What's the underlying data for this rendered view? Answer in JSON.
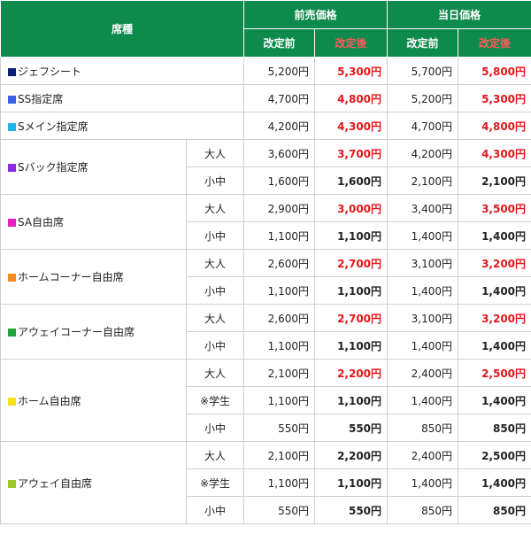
{
  "header": {
    "seat_type": "席種",
    "advance": "前売価格",
    "same_day": "当日価格",
    "before": "改定前",
    "after": "改定後"
  },
  "rows": [
    {
      "seat": "ジェフシート",
      "color": "#0b1f7a",
      "sub": "",
      "adv_old": "5,200円",
      "adv_new": "5,300円",
      "day_old": "5,700円",
      "day_new": "5,800円",
      "red": true
    },
    {
      "seat": "SS指定席",
      "color": "#3a5fe0",
      "sub": "",
      "adv_old": "4,700円",
      "adv_new": "4,800円",
      "day_old": "5,200円",
      "day_new": "5,300円",
      "red": true
    },
    {
      "seat": "Sメイン指定席",
      "color": "#1fb3e8",
      "sub": "",
      "adv_old": "4,200円",
      "adv_new": "4,300円",
      "day_old": "4,700円",
      "day_new": "4,800円",
      "red": true
    },
    {
      "seat": "Sバック指定席",
      "color": "#8b2be0",
      "sub": "大人",
      "adv_old": "3,600円",
      "adv_new": "3,700円",
      "day_old": "4,200円",
      "day_new": "4,300円",
      "red": true
    },
    {
      "seat": "",
      "color": "",
      "sub": "小中",
      "adv_old": "1,600円",
      "adv_new": "1,600円",
      "day_old": "2,100円",
      "day_new": "2,100円",
      "red": false
    },
    {
      "seat": "SA自由席",
      "color": "#e91ec2",
      "sub": "大人",
      "adv_old": "2,900円",
      "adv_new": "3,000円",
      "day_old": "3,400円",
      "day_new": "3,500円",
      "red": true
    },
    {
      "seat": "",
      "color": "",
      "sub": "小中",
      "adv_old": "1,100円",
      "adv_new": "1,100円",
      "day_old": "1,400円",
      "day_new": "1,400円",
      "red": false
    },
    {
      "seat": "ホームコーナー自由席",
      "color": "#f28c1f",
      "sub": "大人",
      "adv_old": "2,600円",
      "adv_new": "2,700円",
      "day_old": "3,100円",
      "day_new": "3,200円",
      "red": true
    },
    {
      "seat": "",
      "color": "",
      "sub": "小中",
      "adv_old": "1,100円",
      "adv_new": "1,100円",
      "day_old": "1,400円",
      "day_new": "1,400円",
      "red": false
    },
    {
      "seat": "アウェイコーナー自由席",
      "color": "#1fa33a",
      "sub": "大人",
      "adv_old": "2,600円",
      "adv_new": "2,700円",
      "day_old": "3,100円",
      "day_new": "3,200円",
      "red": true
    },
    {
      "seat": "",
      "color": "",
      "sub": "小中",
      "adv_old": "1,100円",
      "adv_new": "1,100円",
      "day_old": "1,400円",
      "day_new": "1,400円",
      "red": false
    },
    {
      "seat": "ホーム自由席",
      "color": "#f2e21a",
      "sub": "大人",
      "adv_old": "2,100円",
      "adv_new": "2,200円",
      "day_old": "2,400円",
      "day_new": "2,500円",
      "red": true
    },
    {
      "seat": "",
      "color": "",
      "sub": "※学生",
      "adv_old": "1,100円",
      "adv_new": "1,100円",
      "day_old": "1,400円",
      "day_new": "1,400円",
      "red": false
    },
    {
      "seat": "",
      "color": "",
      "sub": "小中",
      "adv_old": "550円",
      "adv_new": "550円",
      "day_old": "850円",
      "day_new": "850円",
      "red": false
    },
    {
      "seat": "アウェイ自由席",
      "color": "#9cc82a",
      "sub": "大人",
      "adv_old": "2,100円",
      "adv_new": "2,200円",
      "day_old": "2,400円",
      "day_new": "2,500円",
      "red": false
    },
    {
      "seat": "",
      "color": "",
      "sub": "※学生",
      "adv_old": "1,100円",
      "adv_new": "1,100円",
      "day_old": "1,400円",
      "day_new": "1,400円",
      "red": false
    },
    {
      "seat": "",
      "color": "",
      "sub": "小中",
      "adv_old": "550円",
      "adv_new": "550円",
      "day_old": "850円",
      "day_new": "850円",
      "red": false
    }
  ]
}
